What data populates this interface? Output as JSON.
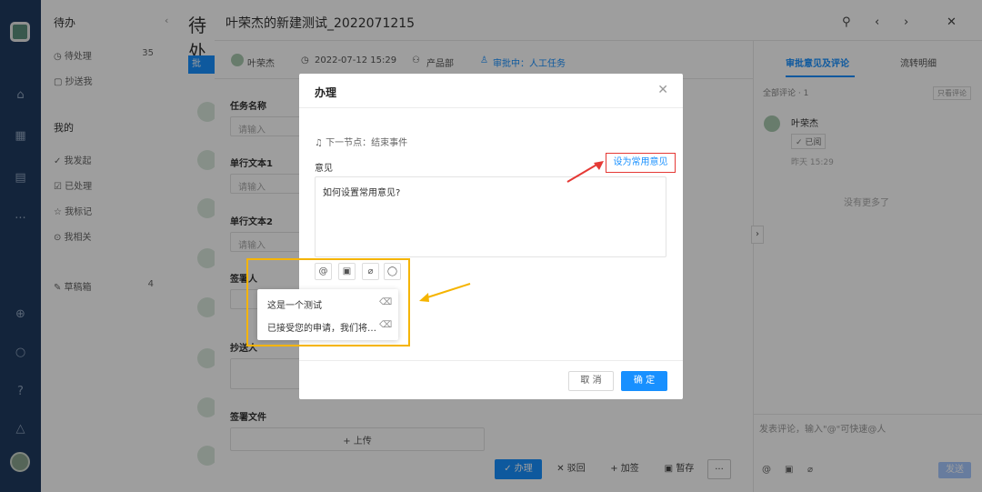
{
  "sidebar_nav": {
    "icons": [
      "home-icon",
      "apps-icon",
      "doc-icon",
      "more-icon",
      "add-icon",
      "search-icon",
      "help-icon",
      "bell-icon"
    ]
  },
  "todo": {
    "title": "待办",
    "items": [
      {
        "label": "◷ 待处理",
        "count": "35"
      },
      {
        "label": "▢ 抄送我",
        "count": ""
      }
    ],
    "mine_title": "我的",
    "mine_items": [
      {
        "label": "✓ 我发起"
      },
      {
        "label": "☑ 已处理"
      },
      {
        "label": "☆ 我标记"
      },
      {
        "label": "⊙ 我相关"
      }
    ],
    "drafts": {
      "label": "✎ 草稿箱",
      "count": "4"
    }
  },
  "list": {
    "heading": "待处",
    "tag": "批"
  },
  "panel": {
    "title": "叶荣杰的新建测试_2022071215",
    "meta": {
      "author": "叶荣杰",
      "time": "2022-07-12 15:29",
      "dept": "产品部",
      "status": "审批中：人工任务"
    },
    "fields": [
      {
        "label": "任务名称",
        "placeholder": "请输入"
      },
      {
        "label": "单行文本1",
        "placeholder": "请输入"
      },
      {
        "label": "单行文本2",
        "placeholder": "请输入"
      },
      {
        "label": "签署人",
        "placeholder": ""
      },
      {
        "label": "抄送人",
        "placeholder": ""
      },
      {
        "label": "签署文件",
        "placeholder": ""
      }
    ],
    "upload_label": "+ 上传",
    "bottom_buttons": {
      "handle": "✓ 办理",
      "reject": "✕ 驳回",
      "add_sign": "+ 加签",
      "save": "暂存",
      "more": "···"
    }
  },
  "right": {
    "tab_active": "审批意见及评论",
    "tab_other": "流转明细",
    "all_comments": "全部评论 · 1",
    "only_mine": "只看评论",
    "commenter": "叶荣杰",
    "read_badge": "✓ 已阅",
    "comment_time": "昨天 15:29",
    "no_more": "没有更多了",
    "comment_placeholder": "发表评论，输入\"@\"可快速@人",
    "send": "发送"
  },
  "modal": {
    "title": "办理",
    "next_node": "下一节点：结束事件",
    "opinion_label": "意见",
    "set_common": "设为常用意见",
    "opinion_text": "如何设置常用意见?",
    "popup_items": [
      "这是一个测试",
      "已接受您的申请，我们将…"
    ],
    "cancel": "取 消",
    "confirm": "确 定"
  },
  "colors": {
    "accent": "#1890ff",
    "sidebar": "#1f3a5f",
    "highlight_box": "#f5b400",
    "highlight_red": "#e53935"
  }
}
